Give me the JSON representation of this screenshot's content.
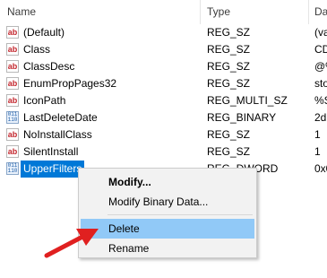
{
  "columns": {
    "name": "Name",
    "type": "Type",
    "data": "Da"
  },
  "rows": [
    {
      "icon": "string-value-icon",
      "name": "(Default)",
      "type": "REG_SZ",
      "data": "(va"
    },
    {
      "icon": "string-value-icon",
      "name": "Class",
      "type": "REG_SZ",
      "data": "CD"
    },
    {
      "icon": "string-value-icon",
      "name": "ClassDesc",
      "type": "REG_SZ",
      "data": "@%"
    },
    {
      "icon": "string-value-icon",
      "name": "EnumPropPages32",
      "type": "REG_SZ",
      "data": "sto"
    },
    {
      "icon": "string-value-icon",
      "name": "IconPath",
      "type": "REG_MULTI_SZ",
      "data": "%S"
    },
    {
      "icon": "binary-value-icon",
      "name": "LastDeleteDate",
      "type": "REG_BINARY",
      "data": "2d"
    },
    {
      "icon": "string-value-icon",
      "name": "NoInstallClass",
      "type": "REG_SZ",
      "data": "1"
    },
    {
      "icon": "string-value-icon",
      "name": "SilentInstall",
      "type": "REG_SZ",
      "data": "1"
    },
    {
      "icon": "binary-value-icon",
      "name": "UpperFilters",
      "type": "REG_DWORD",
      "data": "0x0"
    }
  ],
  "icon_text": {
    "string": "ab",
    "binary": "011\n110"
  },
  "context_menu": {
    "modify": "Modify...",
    "modify_binary": "Modify Binary Data...",
    "delete": "Delete",
    "rename": "Rename"
  },
  "colors": {
    "selection": "#0078d7",
    "menu_highlight": "#91c9f7",
    "arrow": "#e02020"
  }
}
